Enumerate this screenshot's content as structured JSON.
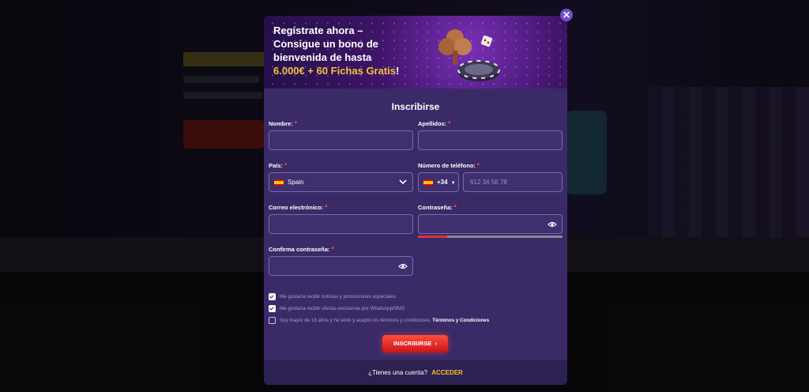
{
  "banner": {
    "line1": "Regístrate ahora –",
    "line2": "Consigue un bono de",
    "line3": "bienvenida de hasta",
    "bonus": "6.000€ + 60 Fichas Gratis",
    "bang": "!"
  },
  "close_icon": "close-icon",
  "form": {
    "title": "Inscribirse",
    "first_name_label": "Nombre:",
    "last_name_label": "Apellidos:",
    "country_label": "País:",
    "country_value": "Spain",
    "phone_label": "Número de teléfono:",
    "phone_code": "+34",
    "phone_placeholder": "612 34 56 78",
    "email_label": "Correo electrónico:",
    "password_label": "Contraseña:",
    "confirm_label": "Confirma contraseña:",
    "required_mark": "*",
    "password_strength": 0.2
  },
  "consents": [
    {
      "text": "Me gustaría recibir noticias y promociones especiales.",
      "checked": true
    },
    {
      "text": "Me gustaría recibir ofertas exclusivas por WhatsApp/SMS",
      "checked": true
    },
    {
      "text": "Soy mayor de 18 años y he leído y acepto los términos y condiciones. ",
      "link": "Términos y Condiciones",
      "checked": false
    }
  ],
  "submit_label": "INSCRIBIRSE",
  "submit_arrow": "›",
  "footer": {
    "question": "¿Tienes una cuenta?",
    "login_label": "ACCEDER"
  },
  "colors": {
    "modal_bg": "#3b2a68",
    "accent_gold": "#f6c23a",
    "cta_red": "#e0261f"
  }
}
